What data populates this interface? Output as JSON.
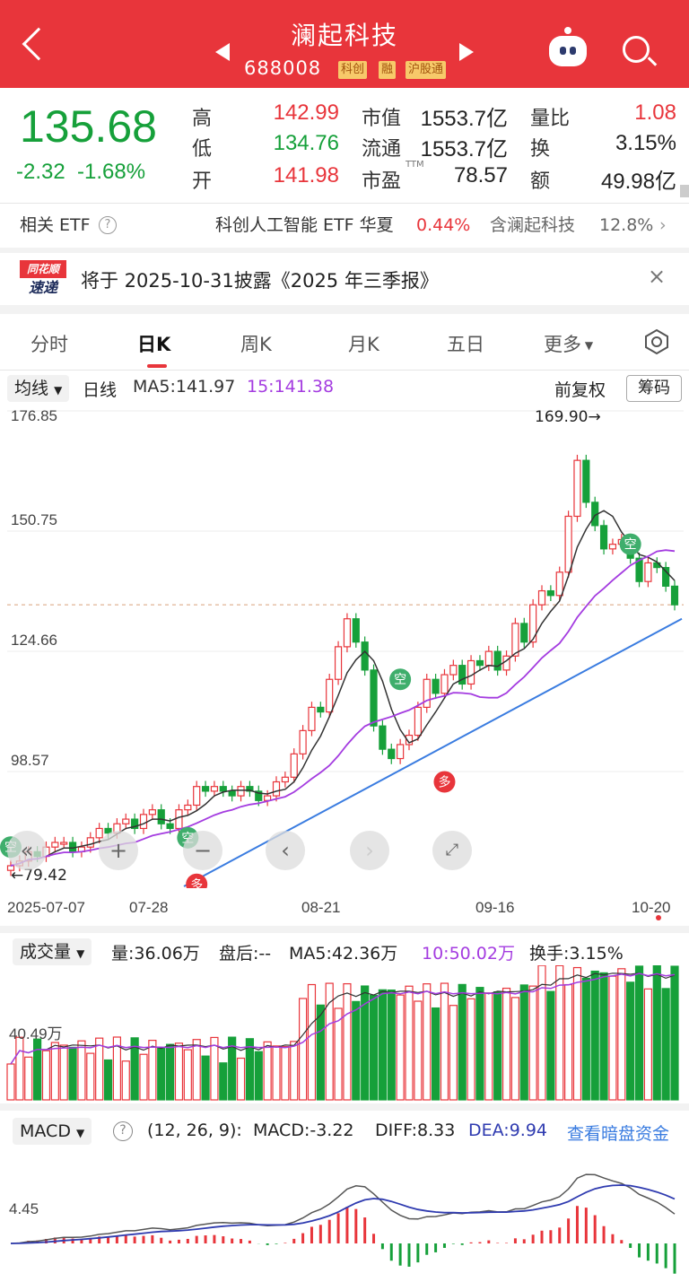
{
  "header": {
    "name": "澜起科技",
    "code": "688008",
    "tags": [
      "科创",
      "融",
      "沪股通"
    ]
  },
  "quote": {
    "price": "135.68",
    "change": "-2.32",
    "change_pct": "-1.68%",
    "rows": [
      {
        "l1": "高",
        "v1": "142.99",
        "l2": "市值",
        "v2": "1553.7亿",
        "l3": "量比",
        "v3": "1.08"
      },
      {
        "l1": "低",
        "v1": "134.76",
        "l2": "流通",
        "v2": "1553.7亿",
        "l3": "换",
        "v3": "3.15%"
      },
      {
        "l1": "开",
        "v1": "141.98",
        "l2": "市盈",
        "v2": "78.57",
        "l3": "额",
        "v3": "49.98亿"
      }
    ],
    "ttm": "TTM"
  },
  "etf": {
    "label": "相关 ETF",
    "name": "科创人工智能 ETF 华夏",
    "pct": "0.44%",
    "hold": "含澜起科技",
    "hold_pct": "12.8%"
  },
  "notice": {
    "logo_top": "同花顺",
    "logo_bottom": "速递",
    "text": "将于 2025-10-31披露《2025 年三季报》"
  },
  "tabs": [
    "分时",
    "日K",
    "周K",
    "月K",
    "五日",
    "更多"
  ],
  "kline": {
    "ma_selector": "均线",
    "period": "日线",
    "ma5": "MA5:141.97",
    "ma15": "15:141.38",
    "adjust": "前复权",
    "chips": "筹码",
    "y_labels": [
      "176.85",
      "150.75",
      "124.66",
      "98.57"
    ],
    "high_marker": "169.90→",
    "low_marker": "←79.42",
    "x_labels": [
      "2025-07-07",
      "07-28",
      "08-21",
      "09-16",
      "10-20"
    ],
    "signals": {
      "empty": "空",
      "long": "多"
    }
  },
  "volume": {
    "selector": "成交量",
    "vol": "量:36.06万",
    "after": "盘后:--",
    "ma5": "MA5:42.36万",
    "ma10": "10:50.02万",
    "turnover": "换手:3.15%",
    "y_label": "40.49万"
  },
  "macd": {
    "selector": "MACD",
    "params": "(12, 26, 9):",
    "macd": "MACD:-3.22",
    "diff": "DIFF:8.33",
    "dea": "DEA:9.94",
    "link": "查看暗盘资金",
    "y_label": "4.45"
  },
  "colors": {
    "up": "#e8353b",
    "down": "#16a03a",
    "ma5": "#333333",
    "ma15": "#a43ce0",
    "trend": "#3a7ce0",
    "dea": "#2f3bb0"
  },
  "chart_data": {
    "type": "candlestick",
    "closes": [
      80,
      81,
      83,
      82,
      84,
      85,
      85,
      83,
      84,
      86,
      88,
      87,
      89,
      90,
      88,
      91,
      92,
      89,
      88,
      92,
      93,
      97,
      96,
      97,
      96,
      95,
      97,
      96,
      94,
      95,
      98,
      99,
      104,
      109,
      114,
      113,
      120,
      127,
      133,
      128,
      122,
      110,
      105,
      103,
      106,
      108,
      114,
      120,
      117,
      121,
      123,
      119,
      124,
      123,
      126,
      122,
      125,
      132,
      128,
      136,
      139,
      138,
      143,
      155,
      167,
      158,
      153,
      148,
      149,
      150,
      146,
      141,
      145,
      144,
      140,
      136
    ],
    "ylim": [
      79.42,
      176.85
    ]
  }
}
